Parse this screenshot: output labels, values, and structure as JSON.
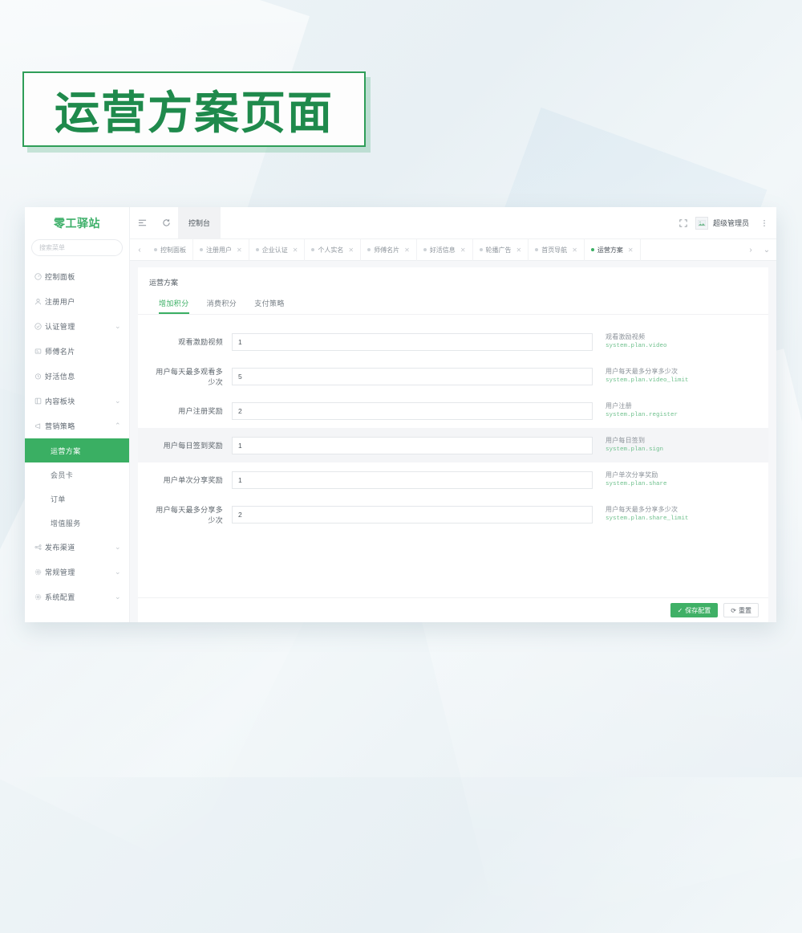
{
  "banner": {
    "title": "运营方案页面"
  },
  "sidebar": {
    "logo": "零工驿站",
    "search_placeholder": "搜索菜单",
    "items": [
      {
        "label": "控制面板",
        "icon": "dashboard-icon",
        "arrow": ""
      },
      {
        "label": "注册用户",
        "icon": "user-icon",
        "arrow": ""
      },
      {
        "label": "认证管理",
        "icon": "badge-check-icon",
        "arrow": "⌄"
      },
      {
        "label": "师傅名片",
        "icon": "card-icon",
        "arrow": ""
      },
      {
        "label": "好活信息",
        "icon": "clock-icon",
        "arrow": ""
      },
      {
        "label": "内容板块",
        "icon": "layout-icon",
        "arrow": "⌄"
      },
      {
        "label": "营销策略",
        "icon": "megaphone-icon",
        "arrow": "⌃"
      }
    ],
    "sub_items": [
      {
        "label": "运营方案",
        "active": true
      },
      {
        "label": "会员卡",
        "active": false
      },
      {
        "label": "订单",
        "active": false
      },
      {
        "label": "增值服务",
        "active": false
      }
    ],
    "items_bottom": [
      {
        "label": "发布渠道",
        "icon": "share-icon",
        "arrow": "⌄"
      },
      {
        "label": "常规管理",
        "icon": "gear-icon",
        "arrow": "⌄"
      },
      {
        "label": "系统配置",
        "icon": "settings-icon",
        "arrow": "⌄"
      }
    ]
  },
  "topbar": {
    "collapse_icon": "menu-collapse-icon",
    "refresh_icon": "refresh-icon",
    "console_label": "控制台",
    "fullscreen_icon": "fullscreen-icon",
    "avatar_icon": "avatar-image-icon",
    "user_name": "超级管理员",
    "more_icon": "more-vertical-icon"
  },
  "tabbar": {
    "prev_icon": "chevron-left-icon",
    "next_icon": "chevron-right-icon",
    "dropdown_icon": "chevron-down-icon",
    "tabs": [
      {
        "label": "控制面板",
        "closable": false,
        "active": false
      },
      {
        "label": "注册用户",
        "closable": true,
        "active": false
      },
      {
        "label": "企业认证",
        "closable": true,
        "active": false
      },
      {
        "label": "个人实名",
        "closable": true,
        "active": false
      },
      {
        "label": "师傅名片",
        "closable": true,
        "active": false
      },
      {
        "label": "好活信息",
        "closable": true,
        "active": false
      },
      {
        "label": "轮播广告",
        "closable": true,
        "active": false
      },
      {
        "label": "首页导航",
        "closable": true,
        "active": false
      },
      {
        "label": "运营方案",
        "closable": true,
        "active": true
      }
    ]
  },
  "page": {
    "title": "运营方案",
    "tabs": [
      {
        "label": "增加积分",
        "active": true
      },
      {
        "label": "消费积分",
        "active": false
      },
      {
        "label": "支付策略",
        "active": false
      }
    ],
    "rows": [
      {
        "label": "观看激励视频",
        "value": "1",
        "hint_title": "观看激励视频",
        "hint_key": "system.plan.video",
        "highlight": false
      },
      {
        "label": "用户每天最多观看多少次",
        "value": "5",
        "hint_title": "用户每天最多分享多少次",
        "hint_key": "system.plan.video_limit",
        "highlight": false
      },
      {
        "label": "用户注册奖励",
        "value": "2",
        "hint_title": "用户注册",
        "hint_key": "system.plan.register",
        "highlight": false
      },
      {
        "label": "用户每日签到奖励",
        "value": "1",
        "hint_title": "用户每日签到",
        "hint_key": "system.plan.sign",
        "highlight": true
      },
      {
        "label": "用户单次分享奖励",
        "value": "1",
        "hint_title": "用户单次分享奖励",
        "hint_key": "system.plan.share",
        "highlight": false
      },
      {
        "label": "用户每天最多分享多少次",
        "value": "2",
        "hint_title": "用户每天最多分享多少次",
        "hint_key": "system.plan.share_limit",
        "highlight": false
      }
    ],
    "footer": {
      "save_label": "保存配置",
      "save_icon": "check-icon",
      "reset_label": "重置",
      "reset_icon": "refresh-icon"
    }
  },
  "colors": {
    "brand_green": "#3aaf63",
    "title_green": "#1f8a4c",
    "hint_green": "#6fc08d",
    "page_bg": "#eef4f7"
  }
}
